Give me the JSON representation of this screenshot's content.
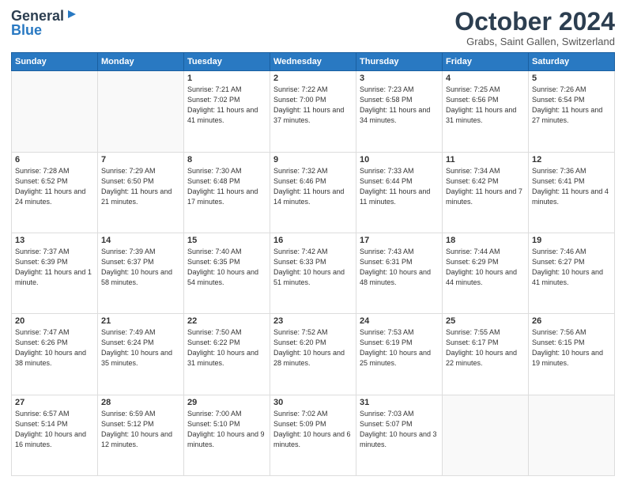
{
  "header": {
    "logo_line1": "General",
    "logo_line2": "Blue",
    "month_title": "October 2024",
    "location": "Grabs, Saint Gallen, Switzerland"
  },
  "days_of_week": [
    "Sunday",
    "Monday",
    "Tuesday",
    "Wednesday",
    "Thursday",
    "Friday",
    "Saturday"
  ],
  "weeks": [
    [
      {
        "day": "",
        "info": ""
      },
      {
        "day": "",
        "info": ""
      },
      {
        "day": "1",
        "info": "Sunrise: 7:21 AM\nSunset: 7:02 PM\nDaylight: 11 hours and 41 minutes."
      },
      {
        "day": "2",
        "info": "Sunrise: 7:22 AM\nSunset: 7:00 PM\nDaylight: 11 hours and 37 minutes."
      },
      {
        "day": "3",
        "info": "Sunrise: 7:23 AM\nSunset: 6:58 PM\nDaylight: 11 hours and 34 minutes."
      },
      {
        "day": "4",
        "info": "Sunrise: 7:25 AM\nSunset: 6:56 PM\nDaylight: 11 hours and 31 minutes."
      },
      {
        "day": "5",
        "info": "Sunrise: 7:26 AM\nSunset: 6:54 PM\nDaylight: 11 hours and 27 minutes."
      }
    ],
    [
      {
        "day": "6",
        "info": "Sunrise: 7:28 AM\nSunset: 6:52 PM\nDaylight: 11 hours and 24 minutes."
      },
      {
        "day": "7",
        "info": "Sunrise: 7:29 AM\nSunset: 6:50 PM\nDaylight: 11 hours and 21 minutes."
      },
      {
        "day": "8",
        "info": "Sunrise: 7:30 AM\nSunset: 6:48 PM\nDaylight: 11 hours and 17 minutes."
      },
      {
        "day": "9",
        "info": "Sunrise: 7:32 AM\nSunset: 6:46 PM\nDaylight: 11 hours and 14 minutes."
      },
      {
        "day": "10",
        "info": "Sunrise: 7:33 AM\nSunset: 6:44 PM\nDaylight: 11 hours and 11 minutes."
      },
      {
        "day": "11",
        "info": "Sunrise: 7:34 AM\nSunset: 6:42 PM\nDaylight: 11 hours and 7 minutes."
      },
      {
        "day": "12",
        "info": "Sunrise: 7:36 AM\nSunset: 6:41 PM\nDaylight: 11 hours and 4 minutes."
      }
    ],
    [
      {
        "day": "13",
        "info": "Sunrise: 7:37 AM\nSunset: 6:39 PM\nDaylight: 11 hours and 1 minute."
      },
      {
        "day": "14",
        "info": "Sunrise: 7:39 AM\nSunset: 6:37 PM\nDaylight: 10 hours and 58 minutes."
      },
      {
        "day": "15",
        "info": "Sunrise: 7:40 AM\nSunset: 6:35 PM\nDaylight: 10 hours and 54 minutes."
      },
      {
        "day": "16",
        "info": "Sunrise: 7:42 AM\nSunset: 6:33 PM\nDaylight: 10 hours and 51 minutes."
      },
      {
        "day": "17",
        "info": "Sunrise: 7:43 AM\nSunset: 6:31 PM\nDaylight: 10 hours and 48 minutes."
      },
      {
        "day": "18",
        "info": "Sunrise: 7:44 AM\nSunset: 6:29 PM\nDaylight: 10 hours and 44 minutes."
      },
      {
        "day": "19",
        "info": "Sunrise: 7:46 AM\nSunset: 6:27 PM\nDaylight: 10 hours and 41 minutes."
      }
    ],
    [
      {
        "day": "20",
        "info": "Sunrise: 7:47 AM\nSunset: 6:26 PM\nDaylight: 10 hours and 38 minutes."
      },
      {
        "day": "21",
        "info": "Sunrise: 7:49 AM\nSunset: 6:24 PM\nDaylight: 10 hours and 35 minutes."
      },
      {
        "day": "22",
        "info": "Sunrise: 7:50 AM\nSunset: 6:22 PM\nDaylight: 10 hours and 31 minutes."
      },
      {
        "day": "23",
        "info": "Sunrise: 7:52 AM\nSunset: 6:20 PM\nDaylight: 10 hours and 28 minutes."
      },
      {
        "day": "24",
        "info": "Sunrise: 7:53 AM\nSunset: 6:19 PM\nDaylight: 10 hours and 25 minutes."
      },
      {
        "day": "25",
        "info": "Sunrise: 7:55 AM\nSunset: 6:17 PM\nDaylight: 10 hours and 22 minutes."
      },
      {
        "day": "26",
        "info": "Sunrise: 7:56 AM\nSunset: 6:15 PM\nDaylight: 10 hours and 19 minutes."
      }
    ],
    [
      {
        "day": "27",
        "info": "Sunrise: 6:57 AM\nSunset: 5:14 PM\nDaylight: 10 hours and 16 minutes."
      },
      {
        "day": "28",
        "info": "Sunrise: 6:59 AM\nSunset: 5:12 PM\nDaylight: 10 hours and 12 minutes."
      },
      {
        "day": "29",
        "info": "Sunrise: 7:00 AM\nSunset: 5:10 PM\nDaylight: 10 hours and 9 minutes."
      },
      {
        "day": "30",
        "info": "Sunrise: 7:02 AM\nSunset: 5:09 PM\nDaylight: 10 hours and 6 minutes."
      },
      {
        "day": "31",
        "info": "Sunrise: 7:03 AM\nSunset: 5:07 PM\nDaylight: 10 hours and 3 minutes."
      },
      {
        "day": "",
        "info": ""
      },
      {
        "day": "",
        "info": ""
      }
    ]
  ]
}
